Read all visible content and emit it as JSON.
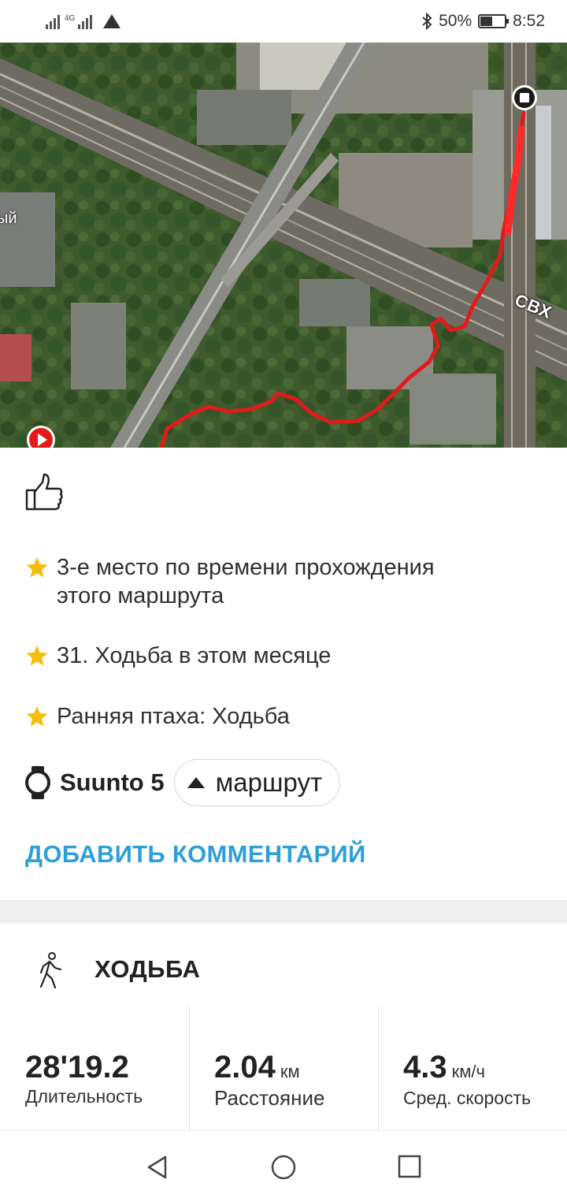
{
  "status_bar": {
    "network": "4G",
    "battery": "50%",
    "battery_level": 0.5,
    "time": "8:52",
    "icons": [
      "signal-icon",
      "signal-icon",
      "vpn-icon",
      "bluetooth-icon",
      "battery-icon"
    ]
  },
  "map": {
    "label_right": "СВХ",
    "label_left": "ый",
    "route_color": "#e11b1b",
    "icons": [
      "start-marker-icon",
      "finish-marker-icon"
    ]
  },
  "like_icon": "thumbs-up-icon",
  "achievements": [
    {
      "icon": "star-icon",
      "text_line1": "3-е место по времени прохождения",
      "text_line2": "этого маршрута"
    },
    {
      "icon": "star-icon",
      "text_line1": "31. Ходьба в этом месяце"
    },
    {
      "icon": "star-icon",
      "text_line1": "Ранняя птаха: Ходьба"
    }
  ],
  "device": {
    "icon": "watch-icon",
    "name": "Suunto 5",
    "route_button": "маршрут",
    "route_icon": "triangle-up-icon"
  },
  "add_comment": "ДОБАВИТЬ КОММЕНТАРИЙ",
  "accent_color": "#2f9fd8",
  "star_color": "#f5bd0c",
  "activity": {
    "icon": "walking-icon",
    "title": "ХОДЬБА",
    "stats": [
      {
        "value": "28'19.2",
        "unit": "",
        "label": "Длительность"
      },
      {
        "value": "2.04",
        "unit": "км",
        "label": "Расстояние"
      },
      {
        "value": "4.3",
        "unit": "км/ч",
        "label": "Сред. скорость"
      }
    ]
  },
  "nav": [
    "back-icon",
    "home-icon",
    "recents-icon"
  ]
}
